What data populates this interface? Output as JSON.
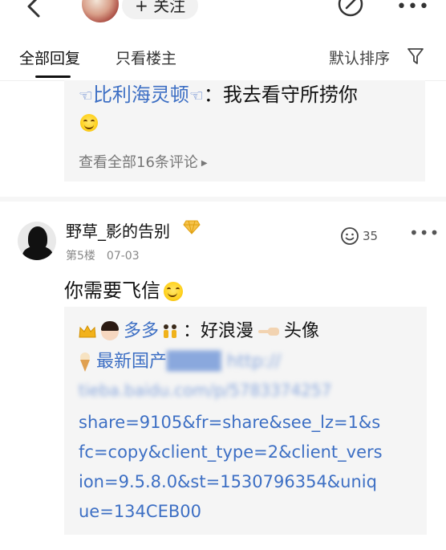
{
  "header": {
    "follow_label": "+ 关注"
  },
  "tabs": {
    "all_replies": "全部回复",
    "op_only": "只看楼主",
    "sort_label": "默认排序"
  },
  "reply_preview": {
    "user": "比利海灵顿",
    "text": "：我去看守所捞你",
    "view_all": "查看全部16条评论"
  },
  "post": {
    "username": "野草_影的告别",
    "floor": "第5楼",
    "date": "07-03",
    "like_count": "35",
    "text": "你需要飞信"
  },
  "sub_reply": {
    "user": "多多",
    "text": "：好浪漫",
    "after_point": "头像",
    "link_prefix": "最新国产",
    "url_lines": [
      "share=9105&fr=share&see_lz=1&s",
      "fc=copy&client_type=2&client_vers",
      "ion=9.5.8.0&st=1530796354&uniq",
      "ue=134CEB00"
    ]
  }
}
